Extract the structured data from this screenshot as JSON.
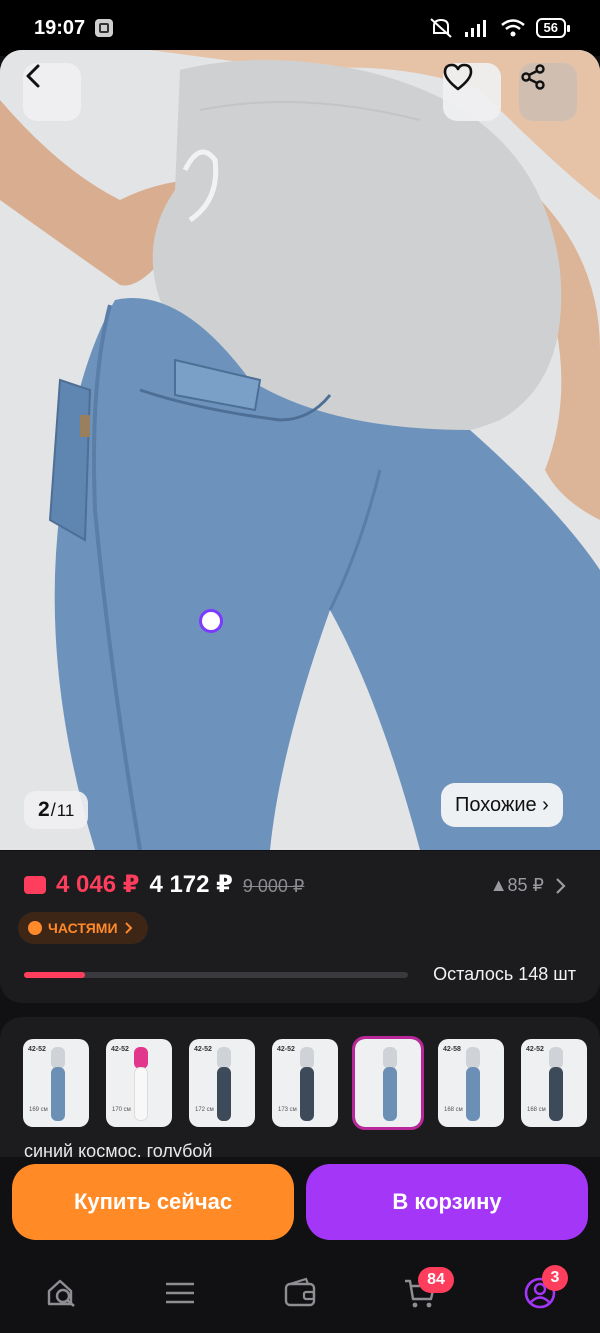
{
  "status_bar": {
    "time": "19:07",
    "battery": "56"
  },
  "gallery": {
    "current": "2",
    "separator": "/",
    "total": "11",
    "similar_label": "Похожие ›"
  },
  "price": {
    "wallet_price": "4 046 ₽",
    "current": "4 172 ₽",
    "old": "9 000 ₽",
    "change": "▲85 ₽"
  },
  "installments_label": "ЧАСТЯМИ",
  "stock": {
    "remaining_label": "Осталось 148 шт",
    "progress_fraction": 0.16
  },
  "variants": {
    "thumbnails": [
      {
        "size": "42-52",
        "height": "169 см",
        "icon": "jeans-variant-light-blue"
      },
      {
        "size": "42-52",
        "height": "170 см",
        "icon": "jeans-variant-white"
      },
      {
        "size": "42-52",
        "height": "172 см",
        "icon": "jeans-variant-dark-blue"
      },
      {
        "size": "42-52",
        "height": "173 см",
        "icon": "jeans-variant-grey"
      },
      {
        "size": "",
        "height": "",
        "icon": "jeans-variant-selected"
      },
      {
        "size": "42-58",
        "height": "168 см",
        "icon": "jeans-variant-light"
      },
      {
        "size": "42-52",
        "height": "168 см",
        "icon": "jeans-variant-grey-blue"
      }
    ],
    "color_name": "синий космос, голубой"
  },
  "actions": {
    "buy_now": "Купить сейчас",
    "add_to_cart": "В корзину"
  },
  "nav": {
    "items": [
      "search-home-icon",
      "catalog-menu-icon",
      "wallet-icon",
      "cart-icon",
      "profile-icon"
    ],
    "cart_badge": "84",
    "profile_badge": "3"
  },
  "colors": {
    "accent_red": "#ff3d5c",
    "buy_orange": "#ff8a26",
    "cart_purple": "#a437f7"
  }
}
